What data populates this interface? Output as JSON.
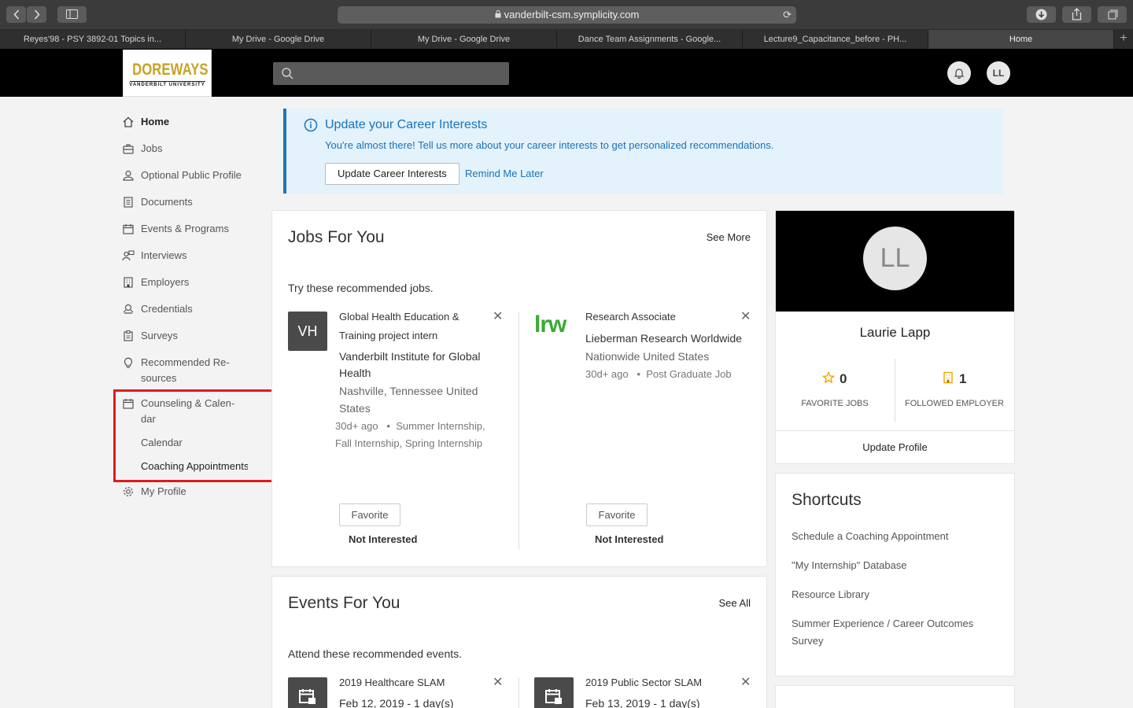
{
  "browser": {
    "url": "vanderbilt-csm.symplicity.com",
    "tabs": [
      {
        "label": "Reyes'98 - PSY 3892-01 Topics in..."
      },
      {
        "label": "My Drive - Google Drive"
      },
      {
        "label": "My Drive - Google Drive"
      },
      {
        "label": "Dance Team Assignments - Google..."
      },
      {
        "label": "Lecture9_Capacitance_before - PH..."
      },
      {
        "label": "Home"
      }
    ]
  },
  "header": {
    "logo_main": "DOREWAYS",
    "logo_sub": "VANDERBILT UNIVERSITY",
    "avatar_initials": "LL"
  },
  "sidebar": {
    "items": [
      {
        "label": "Home",
        "icon": "home-icon"
      },
      {
        "label": "Jobs",
        "icon": "briefcase-icon"
      },
      {
        "label": "Optional Public Profile",
        "icon": "person-icon"
      },
      {
        "label": "Documents",
        "icon": "document-icon"
      },
      {
        "label": "Events & Programs",
        "icon": "calendar-icon"
      },
      {
        "label": "Interviews",
        "icon": "interview-icon"
      },
      {
        "label": "Employers",
        "icon": "building-icon"
      },
      {
        "label": "Credentials",
        "icon": "credentials-icon"
      },
      {
        "label": "Surveys",
        "icon": "clipboard-icon"
      },
      {
        "label": "Recommended Re-sources",
        "line1": "Recommended Re-",
        "line2": "sources",
        "icon": "lightbulb-icon"
      },
      {
        "label": "Counseling & Calendar",
        "line1": "Counseling & Calen-",
        "line2": "dar",
        "icon": "calendar-icon"
      },
      {
        "label": "My Profile",
        "icon": "gear-icon"
      }
    ],
    "sub_items": [
      {
        "label": "Calendar"
      },
      {
        "label": "Coaching Appointments"
      }
    ]
  },
  "banner": {
    "title": "Update your Career Interests",
    "text": "You're almost there! Tell us more about your career interests to get personalized recommendations.",
    "button": "Update Career Interests",
    "link": "Remind Me Later"
  },
  "jobs": {
    "title": "Jobs For You",
    "see_more": "See More",
    "subtitle": "Try these recommended jobs.",
    "items": [
      {
        "logo_text": "VH",
        "title_line1": "Global Health Education &",
        "title_line2": "Training project intern",
        "employer_line1": "Vanderbilt Institute for Global",
        "employer_line2": "Health",
        "location_line1": "Nashville, Tennessee United",
        "location_line2": "States",
        "meta_line1": "30d+ ago   •  Summer Internship,",
        "meta_line2": "Fall Internship, Spring Internship",
        "favorite": "Favorite",
        "not_interested": "Not Interested"
      },
      {
        "logo_text": "lrw",
        "title_line1": "Research Associate",
        "employer_line1": "Lieberman Research Worldwide",
        "location_line1": "Nationwide United States",
        "meta_line1": "30d+ ago   •  Post Graduate Job",
        "favorite": "Favorite",
        "not_interested": "Not Interested"
      }
    ]
  },
  "events": {
    "title": "Events For You",
    "see_all": "See All",
    "subtitle": "Attend these recommended events.",
    "items": [
      {
        "title": "2019 Healthcare SLAM",
        "date": "Feb 12, 2019 - 1 day(s)"
      },
      {
        "title": "2019 Public Sector SLAM",
        "date": "Feb 13, 2019 - 1 day(s)"
      }
    ]
  },
  "profile": {
    "initials": "LL",
    "name": "Laurie Lapp",
    "favorite_jobs_count": "0",
    "favorite_jobs_label": "FAVORITE JOBS",
    "followed_employer_count": "1",
    "followed_employer_label": "FOLLOWED EMPLOYER",
    "update_profile": "Update Profile",
    "accent_color": "#f0a500"
  },
  "shortcuts": {
    "title": "Shortcuts",
    "items": [
      {
        "label": "Schedule a Coaching Appointment"
      },
      {
        "label": "\"My Internship\" Database"
      },
      {
        "label": "Resource Library"
      },
      {
        "label": "Summer Experience / Career Outcomes Survey"
      }
    ]
  },
  "colors": {
    "highlight_box": "#e01b1b",
    "link_blue": "#1a73b8",
    "banner_bg": "#e3f2fb"
  }
}
